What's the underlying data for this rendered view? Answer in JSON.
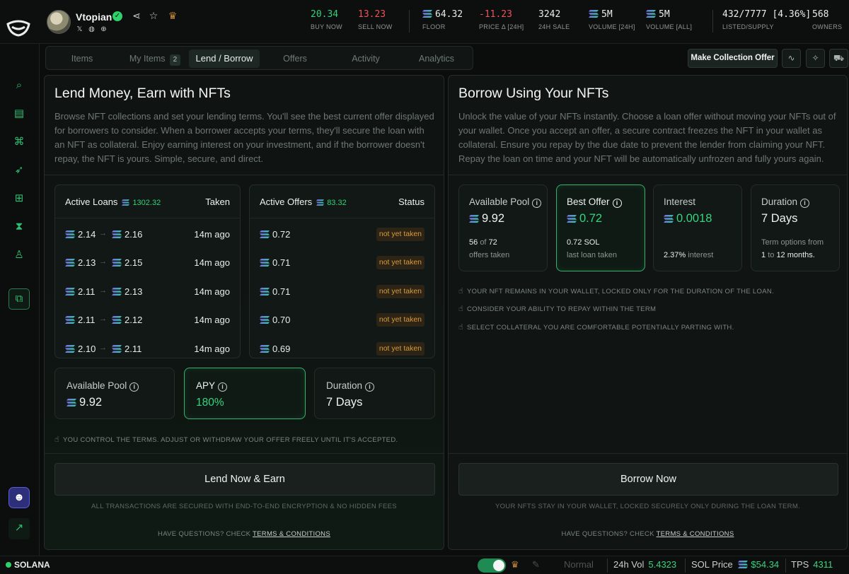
{
  "header": {
    "collection_name": "Vtopian",
    "stats": [
      {
        "value": "20.34",
        "label": "BUY NOW",
        "color": "green"
      },
      {
        "value": "13.23",
        "label": "SELL NOW",
        "color": "red"
      },
      {
        "value": "64.32",
        "label": "FLOOR",
        "sol": true
      },
      {
        "value": "-11.23",
        "label": "PRICE Δ [24H]",
        "color": "red"
      },
      {
        "value": "3242",
        "label": "24H SALE"
      },
      {
        "value": "5M",
        "label": "VOLUME [24H]",
        "sol": true
      },
      {
        "value": "5M",
        "label": "VOLUME [ALL]",
        "sol": true
      },
      {
        "value": "432/7777 [4.36%]",
        "label": "LISTED/SUPPLY"
      },
      {
        "value": "568",
        "label": "OWNERS"
      }
    ]
  },
  "tabs": [
    {
      "label": "Items"
    },
    {
      "label": "My Items",
      "badge": "2"
    },
    {
      "label": "Lend / Borrow",
      "active": true
    },
    {
      "label": "Offers"
    },
    {
      "label": "Activity"
    },
    {
      "label": "Analytics"
    }
  ],
  "toolbar": {
    "collection_offer": "Make Collection Offer"
  },
  "lend": {
    "title": "Lend Money, Earn with NFTs",
    "description": "Browse NFT collections and set your lending terms. You'll see the best current offer displayed for borrowers to consider. When a borrower accepts your terms, they'll secure the loan with an NFT as collateral. Enjoy earning interest on your investment, and if the borrower doesn't repay, the NFT is yours. Simple, secure, and direct.",
    "active_loans": {
      "title": "Active Loans",
      "amount": "1302.32",
      "col": "Taken",
      "rows": [
        {
          "from": "2.14",
          "to": "2.16",
          "ago": "14m ago"
        },
        {
          "from": "2.13",
          "to": "2.15",
          "ago": "14m ago"
        },
        {
          "from": "2.11",
          "to": "2.13",
          "ago": "14m ago"
        },
        {
          "from": "2.11",
          "to": "2.12",
          "ago": "14m ago"
        },
        {
          "from": "2.10",
          "to": "2.11",
          "ago": "14m ago"
        }
      ]
    },
    "active_offers": {
      "title": "Active Offers",
      "amount": "83.32",
      "col": "Status",
      "rows": [
        {
          "value": "0.72",
          "status": "not yet taken"
        },
        {
          "value": "0.71",
          "status": "not yet taken"
        },
        {
          "value": "0.71",
          "status": "not yet taken"
        },
        {
          "value": "0.70",
          "status": "not yet taken"
        },
        {
          "value": "0.69",
          "status": "not yet taken"
        }
      ]
    },
    "metrics": {
      "pool_label": "Available Pool",
      "pool_value": "9.92",
      "apy_label": "APY",
      "apy_value": "180%",
      "duration_label": "Duration",
      "duration_value": "7 Days"
    },
    "note": "YOU CONTROL THE TERMS. ADJUST OR WITHDRAW YOUR OFFER FREELY UNTIL IT'S ACCEPTED.",
    "button": "Lend Now & Earn",
    "secure_note": "ALL TRANSACTIONS ARE SECURED WITH END-TO-END ENCRYPTION & NO HIDDEN FEES",
    "questions": "HAVE QUESTIONS? CHECK",
    "terms_link": "TERMS & CONDITIONS"
  },
  "borrow": {
    "title": "Borrow Using Your NFTs",
    "description": "Unlock the value of your NFTs instantly. Choose a loan offer without moving your NFTs out of your wallet. Once you accept an offer, a secure contract freezes the NFT in your wallet as collateral. Ensure you repay by the due date to prevent the lender from claiming your NFT. Repay the loan on time and your NFT will be automatically unfrozen and fully yours again.",
    "pool": {
      "label": "Available Pool",
      "value": "9.92",
      "sub_num": "56",
      "sub_of": "of",
      "sub_total": "72",
      "sub_text": "offers taken"
    },
    "best": {
      "label": "Best Offer",
      "value": "0.72",
      "sub_val": "0.72 SOL",
      "sub_text": "last loan taken"
    },
    "interest": {
      "label": "Interest",
      "value": "0.0018",
      "sub_pct": "2.37%",
      "sub_text": "interest"
    },
    "duration": {
      "label": "Duration",
      "value": "7 Days",
      "sub1": "Term options from",
      "sub_a": "1",
      "sub_to": "to",
      "sub_b": "12 months."
    },
    "notes": [
      "YOUR NFT REMAINS IN YOUR WALLET, LOCKED ONLY FOR THE DURATION OF THE LOAN.",
      "CONSIDER YOUR ABILITY TO REPAY WITHIN THE TERM",
      "SELECT COLLATERAL YOU ARE COMFORTABLE POTENTIALLY PARTING WITH."
    ],
    "button": "Borrow Now",
    "secure_note": "YOUR NFTS STAY IN YOUR WALLET, LOCKED SECURELY ONLY DURING THE LOAN TERM.",
    "questions": "HAVE QUESTIONS? CHECK",
    "terms_link": "TERMS & CONDITIONS"
  },
  "bottom": {
    "chain": "SOLANA",
    "mode": "Normal",
    "vol_label": "24h Vol",
    "vol_value": "5.4323",
    "sol_label": "SOL Price",
    "sol_value": "$54.34",
    "tps_label": "TPS",
    "tps_value": "4311"
  },
  "colors": {
    "accent": "#34d17a",
    "negative": "#f0525c",
    "warning": "#d69b3c"
  }
}
